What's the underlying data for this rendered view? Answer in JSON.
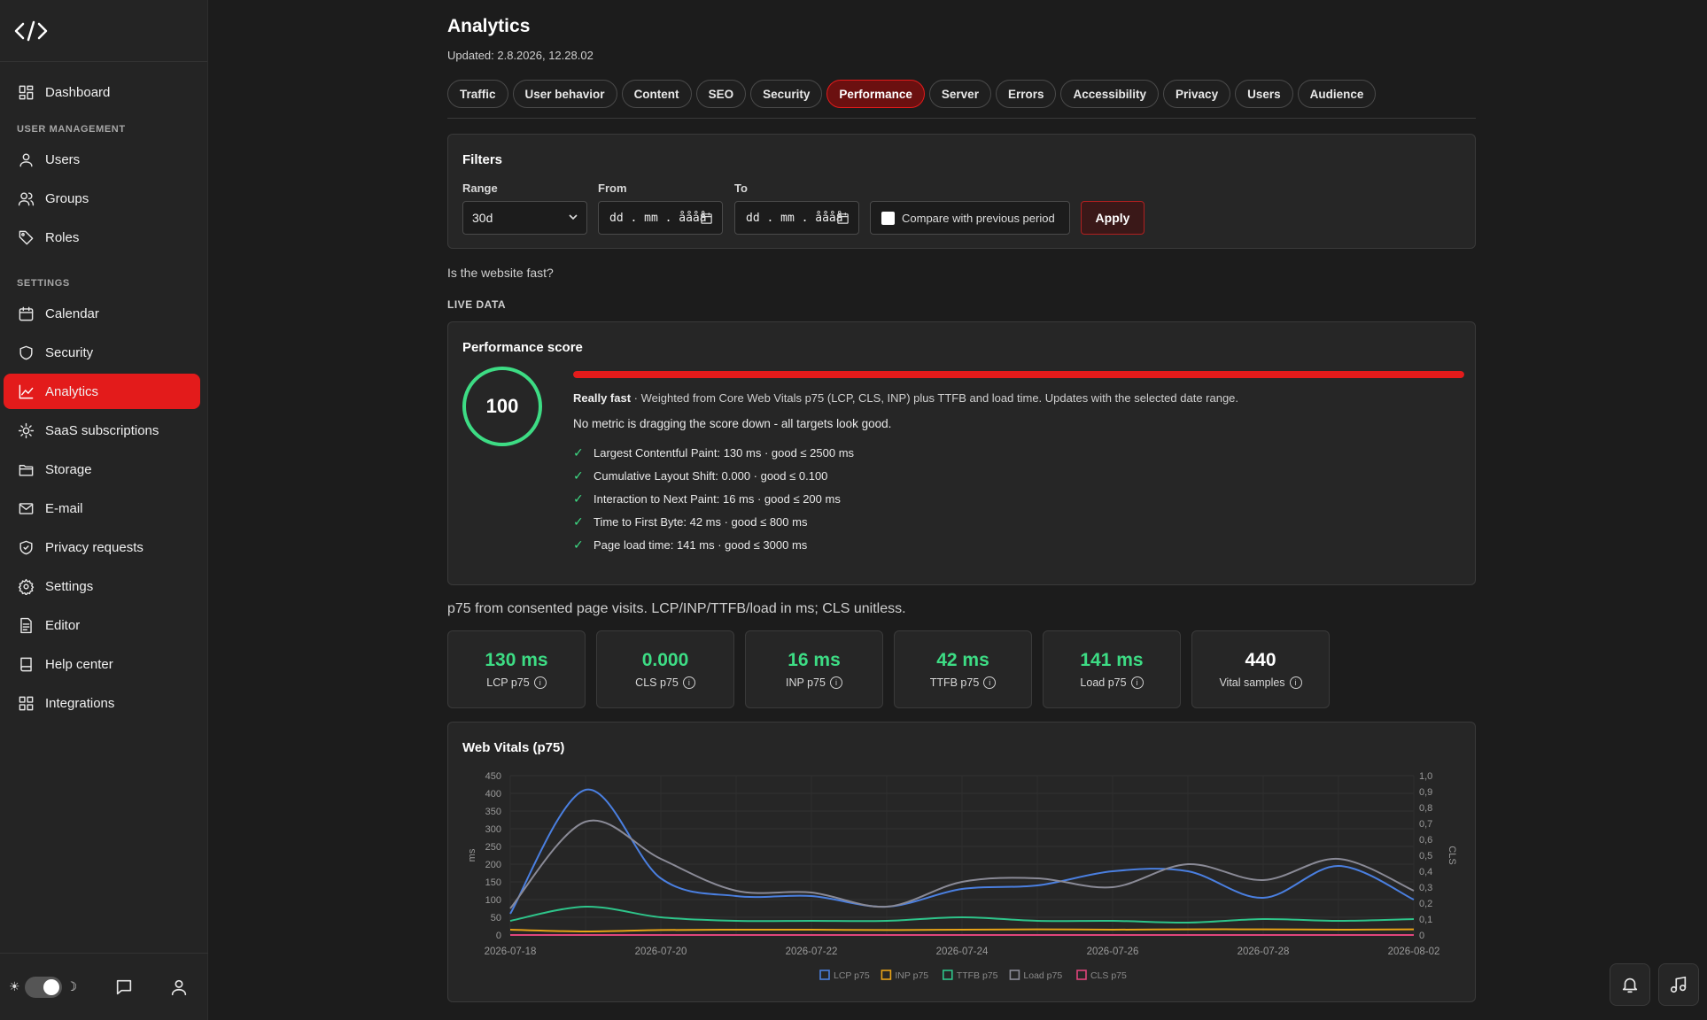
{
  "sidebar": {
    "items": [
      {
        "label": "Dashboard",
        "icon": "dashboard-icon"
      },
      {
        "section": "USER MANAGEMENT"
      },
      {
        "label": "Users",
        "icon": "user-icon"
      },
      {
        "label": "Groups",
        "icon": "users-icon"
      },
      {
        "label": "Roles",
        "icon": "tag-icon"
      },
      {
        "section": "SETTINGS"
      },
      {
        "label": "Calendar",
        "icon": "calendar-icon"
      },
      {
        "label": "Security",
        "icon": "shield-icon"
      },
      {
        "label": "Analytics",
        "icon": "chart-line-icon",
        "active": true
      },
      {
        "label": "SaaS subscriptions",
        "icon": "sun-icon"
      },
      {
        "label": "Storage",
        "icon": "folder-icon"
      },
      {
        "label": "E-mail",
        "icon": "mail-icon"
      },
      {
        "label": "Privacy requests",
        "icon": "shield-check-icon"
      },
      {
        "label": "Settings",
        "icon": "gear-icon"
      },
      {
        "label": "Editor",
        "icon": "file-text-icon"
      },
      {
        "label": "Help center",
        "icon": "book-icon"
      },
      {
        "label": "Integrations",
        "icon": "grid-icon"
      }
    ],
    "footer": {
      "sun": "☀",
      "moon": "☽"
    }
  },
  "header": {
    "title": "Analytics",
    "updated": "Updated: 2.8.2026, 12.28.02"
  },
  "tabs": [
    {
      "label": "Traffic"
    },
    {
      "label": "User behavior"
    },
    {
      "label": "Content"
    },
    {
      "label": "SEO"
    },
    {
      "label": "Security"
    },
    {
      "label": "Performance",
      "active": true
    },
    {
      "label": "Server"
    },
    {
      "label": "Errors"
    },
    {
      "label": "Accessibility"
    },
    {
      "label": "Privacy"
    },
    {
      "label": "Users"
    },
    {
      "label": "Audience"
    }
  ],
  "filters": {
    "title": "Filters",
    "range_label": "Range",
    "range_value": "30d",
    "from_label": "From",
    "from_value": "dd . mm . åååå",
    "to_label": "To",
    "to_value": "dd . mm . åååå",
    "compare_label": "Compare with previous period",
    "apply_label": "Apply"
  },
  "question": "Is the website fast?",
  "live_label": "LIVE DATA",
  "performance": {
    "title": "Performance score",
    "score": "100",
    "score_fraction": 1.0,
    "verdict": "Really fast",
    "description": " · Weighted from Core Web Vitals p75 (LCP, CLS, INP) plus TTFB and load time. Updates with the selected date range.",
    "note": "No metric is dragging the score down - all targets look good.",
    "metrics": [
      "Largest Contentful Paint: 130 ms · good ≤ 2500 ms",
      "Cumulative Layout Shift: 0.000 · good ≤ 0.100",
      "Interaction to Next Paint: 16 ms · good ≤ 200 ms",
      "Time to First Byte: 42 ms · good ≤ 800 ms",
      "Page load time: 141 ms · good ≤ 3000 ms"
    ],
    "check": "✓"
  },
  "p75_note": "p75 from consented page visits. LCP/INP/TTFB/load in ms; CLS unitless.",
  "tiles": [
    {
      "value": "130 ms",
      "label": "LCP p75",
      "color": "#3ddc84"
    },
    {
      "value": "0.000",
      "label": "CLS p75",
      "color": "#3ddc84"
    },
    {
      "value": "16 ms",
      "label": "INP p75",
      "color": "#3ddc84"
    },
    {
      "value": "42 ms",
      "label": "TTFB p75",
      "color": "#3ddc84"
    },
    {
      "value": "141 ms",
      "label": "Load p75",
      "color": "#3ddc84"
    },
    {
      "value": "440",
      "label": "Vital samples",
      "color": "#ffffff"
    }
  ],
  "info_glyph": "i",
  "chart_data": {
    "type": "line",
    "title": "Web Vitals (p75)",
    "xlabel": "",
    "ylabel": "ms",
    "y2label": "CLS",
    "ylim": [
      0,
      450
    ],
    "y2lim": [
      0,
      1.0
    ],
    "y_ticks": [
      0,
      50,
      100,
      150,
      200,
      250,
      300,
      350,
      400,
      450
    ],
    "y2_ticks": [
      "0",
      "0,1",
      "0,2",
      "0,3",
      "0,4",
      "0,5",
      "0,6",
      "0,7",
      "0,8",
      "0,9",
      "1,0"
    ],
    "x": [
      "2026-07-18",
      "2026-07-19",
      "2026-07-20",
      "2026-07-21",
      "2026-07-22",
      "2026-07-23",
      "2026-07-24",
      "2026-07-25",
      "2026-07-26",
      "2026-07-27",
      "2026-07-28",
      "2026-07-29",
      "2026-08-02"
    ],
    "x_tick_labels": [
      "2026-07-18",
      "2026-07-20",
      "2026-07-22",
      "2026-07-24",
      "2026-07-26",
      "2026-07-28",
      "2026-08-02"
    ],
    "grid": true,
    "legend": "bottom-center",
    "series": [
      {
        "name": "LCP p75",
        "color": "#4a7fe0",
        "axis": "left",
        "values": [
          60,
          410,
          160,
          110,
          110,
          80,
          130,
          140,
          180,
          180,
          105,
          195,
          100
        ]
      },
      {
        "name": "INP p75",
        "color": "#e8a317",
        "axis": "left",
        "values": [
          15,
          10,
          14,
          15,
          15,
          14,
          15,
          16,
          15,
          16,
          16,
          15,
          16
        ]
      },
      {
        "name": "TTFB p75",
        "color": "#2ec48a",
        "axis": "left",
        "values": [
          40,
          80,
          50,
          40,
          40,
          40,
          50,
          40,
          40,
          35,
          45,
          40,
          45
        ]
      },
      {
        "name": "Load p75",
        "color": "#8a8a96",
        "axis": "left",
        "values": [
          75,
          320,
          215,
          125,
          120,
          80,
          150,
          160,
          135,
          200,
          155,
          215,
          125
        ]
      },
      {
        "name": "CLS p75",
        "color": "#e0457b",
        "axis": "right",
        "values": [
          0,
          0,
          0,
          0,
          0,
          0,
          0,
          0,
          0,
          0,
          0,
          0,
          0
        ]
      }
    ]
  }
}
